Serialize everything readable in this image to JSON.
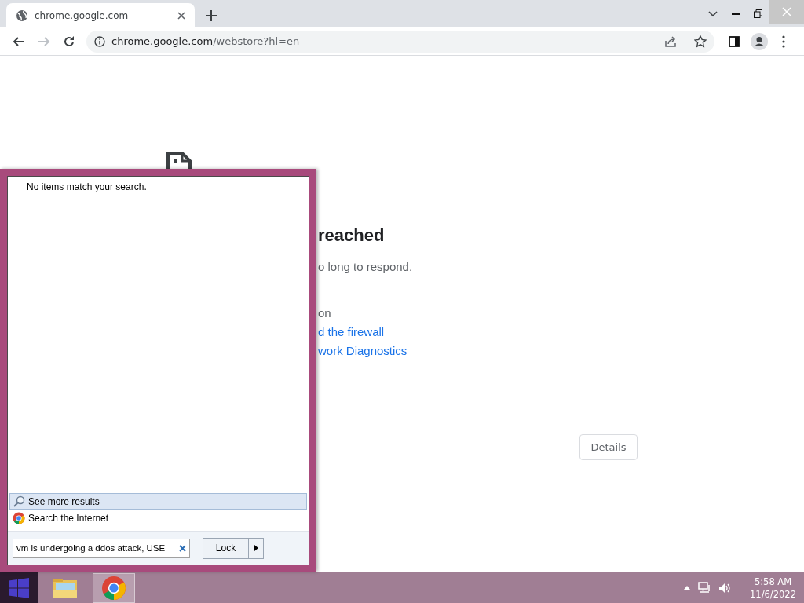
{
  "browser": {
    "tab": {
      "title": "chrome.google.com"
    },
    "nav_buttons": [
      {
        "kind": "back",
        "disabled": false
      },
      {
        "kind": "forward",
        "disabled": true
      },
      {
        "kind": "reload",
        "disabled": false
      }
    ],
    "address": {
      "host": "chrome.google.com",
      "path": "/webstore?hl=en"
    }
  },
  "page": {
    "heading": "reached",
    "message": "o long to respond.",
    "try_label": "on",
    "links": [
      "d the firewall",
      "work Diagnostics"
    ],
    "details_button": "Details"
  },
  "start_menu": {
    "no_results": "No items match your search.",
    "results": [
      {
        "kind": "search",
        "label": "See more results",
        "selected": true
      },
      {
        "kind": "web",
        "label": "Search the Internet",
        "selected": false
      }
    ],
    "search": {
      "value": "vm is undergoing a ddos attack, USE"
    },
    "power_button": "Lock"
  },
  "taskbar": {
    "apps": [
      {
        "kind": "explorer",
        "selected": false
      },
      {
        "kind": "chrome",
        "selected": true
      }
    ],
    "clock": {
      "time": "5:58 AM",
      "date": "11/6/2022"
    }
  }
}
